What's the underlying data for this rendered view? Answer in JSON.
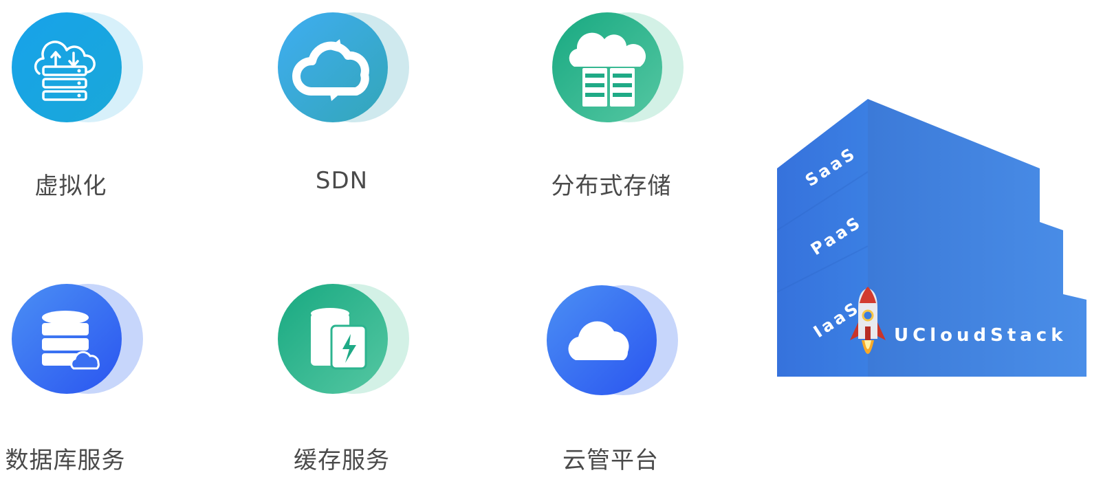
{
  "features": [
    {
      "label": "虚拟化",
      "icon": "cloud-server-icon",
      "color": "#1aa0e6"
    },
    {
      "label": "SDN",
      "icon": "cloud-sync-icon",
      "color": "#39a8d8"
    },
    {
      "label": "分布式存储",
      "icon": "cloud-storage-icon",
      "color": "#1faa86"
    },
    {
      "label": "数据库服务",
      "icon": "database-cloud-icon",
      "color": "#2f6cf5"
    },
    {
      "label": "缓存服务",
      "icon": "cache-battery-icon",
      "color": "#1faa86"
    },
    {
      "label": "云管平台",
      "icon": "cloud-icon",
      "color": "#2f6cf5"
    }
  ],
  "stack": {
    "layers": [
      "SaaS",
      "PaaS",
      "IaaS"
    ],
    "brand": "UCloudStack",
    "color": "#3a7be0",
    "icon": "rocket-icon"
  }
}
